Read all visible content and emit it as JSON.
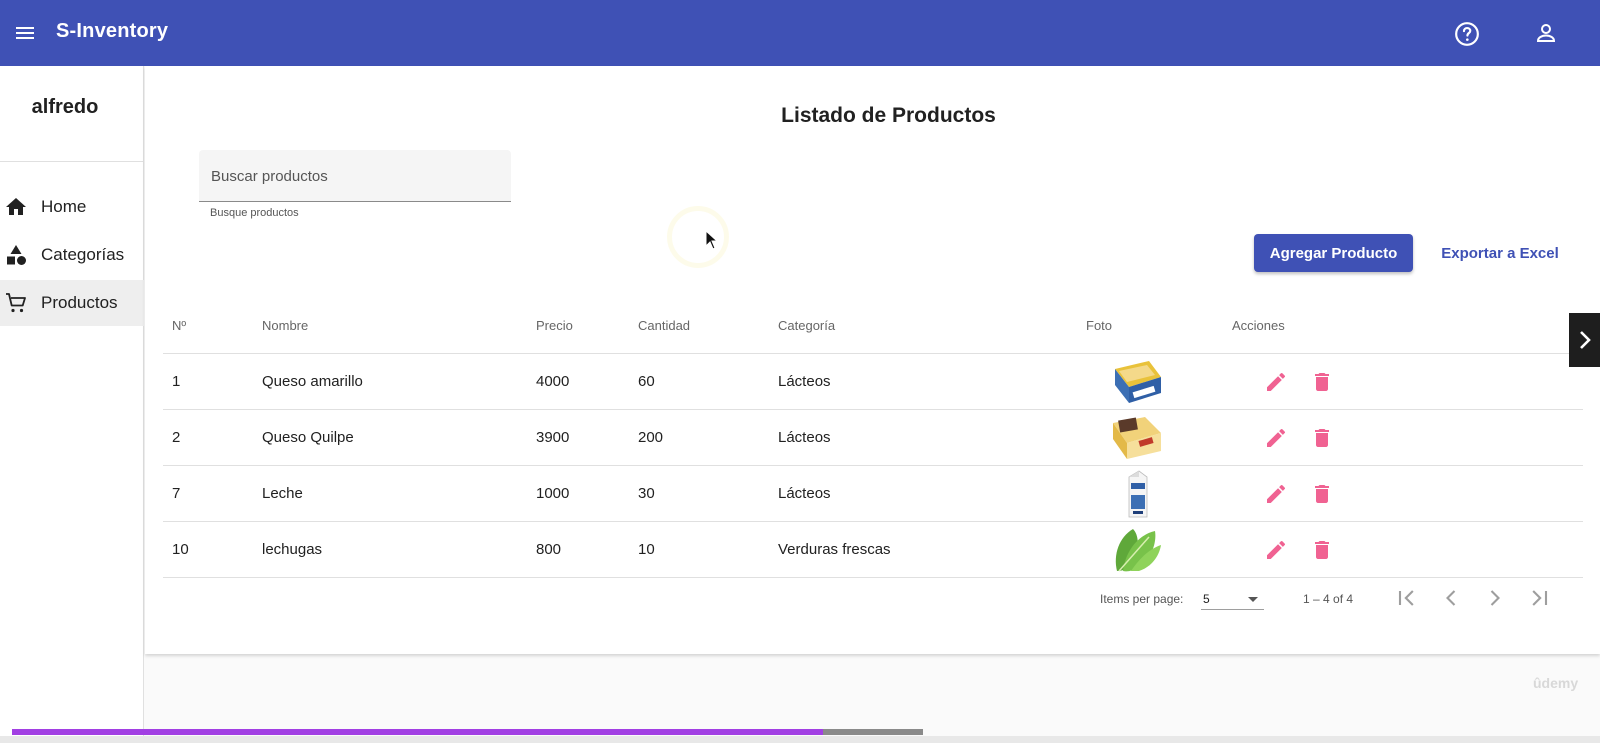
{
  "toolbar": {
    "title": "S-Inventory",
    "menu_icon": "menu-icon",
    "help_icon": "help-icon",
    "user_icon": "account-icon",
    "color": "#3f51b5"
  },
  "sidebar": {
    "username": "alfredo",
    "items": [
      {
        "label": "Home",
        "icon": "home-icon",
        "active": false
      },
      {
        "label": "Categorías",
        "icon": "categories-icon",
        "active": false
      },
      {
        "label": "Productos",
        "icon": "cart-icon",
        "active": true
      }
    ]
  },
  "main": {
    "title": "Listado de Productos",
    "search": {
      "placeholder": "Buscar productos",
      "value": "",
      "hint": "Busque productos"
    },
    "add_button": "Agregar Producto",
    "export_button": "Exportar a Excel",
    "table": {
      "columns": [
        "Nº",
        "Nombre",
        "Precio",
        "Cantidad",
        "Categoría",
        "Foto",
        "Acciones"
      ],
      "rows": [
        {
          "id": "1",
          "nombre": "Queso amarillo",
          "precio": "4000",
          "cantidad": "60",
          "categoria": "Lácteos",
          "foto": "cheese-package-image"
        },
        {
          "id": "2",
          "nombre": "Queso Quilpe",
          "precio": "3900",
          "cantidad": "200",
          "categoria": "Lácteos",
          "foto": "cheese-slices-image"
        },
        {
          "id": "7",
          "nombre": "Leche",
          "precio": "1000",
          "cantidad": "30",
          "categoria": "Lácteos",
          "foto": "milk-carton-image"
        },
        {
          "id": "10",
          "nombre": "lechugas",
          "precio": "800",
          "cantidad": "10",
          "categoria": "Verduras frescas",
          "foto": "lettuce-image"
        }
      ]
    },
    "paginator": {
      "items_per_page_label": "Items per page:",
      "items_per_page": "5",
      "range": "1 – 4 of 4"
    }
  },
  "watermark": "ûdemy",
  "video": {
    "progress": 0.89
  },
  "colors": {
    "accent": "#3f51b5",
    "action": "#f06292",
    "progress": "#a23fe3"
  }
}
